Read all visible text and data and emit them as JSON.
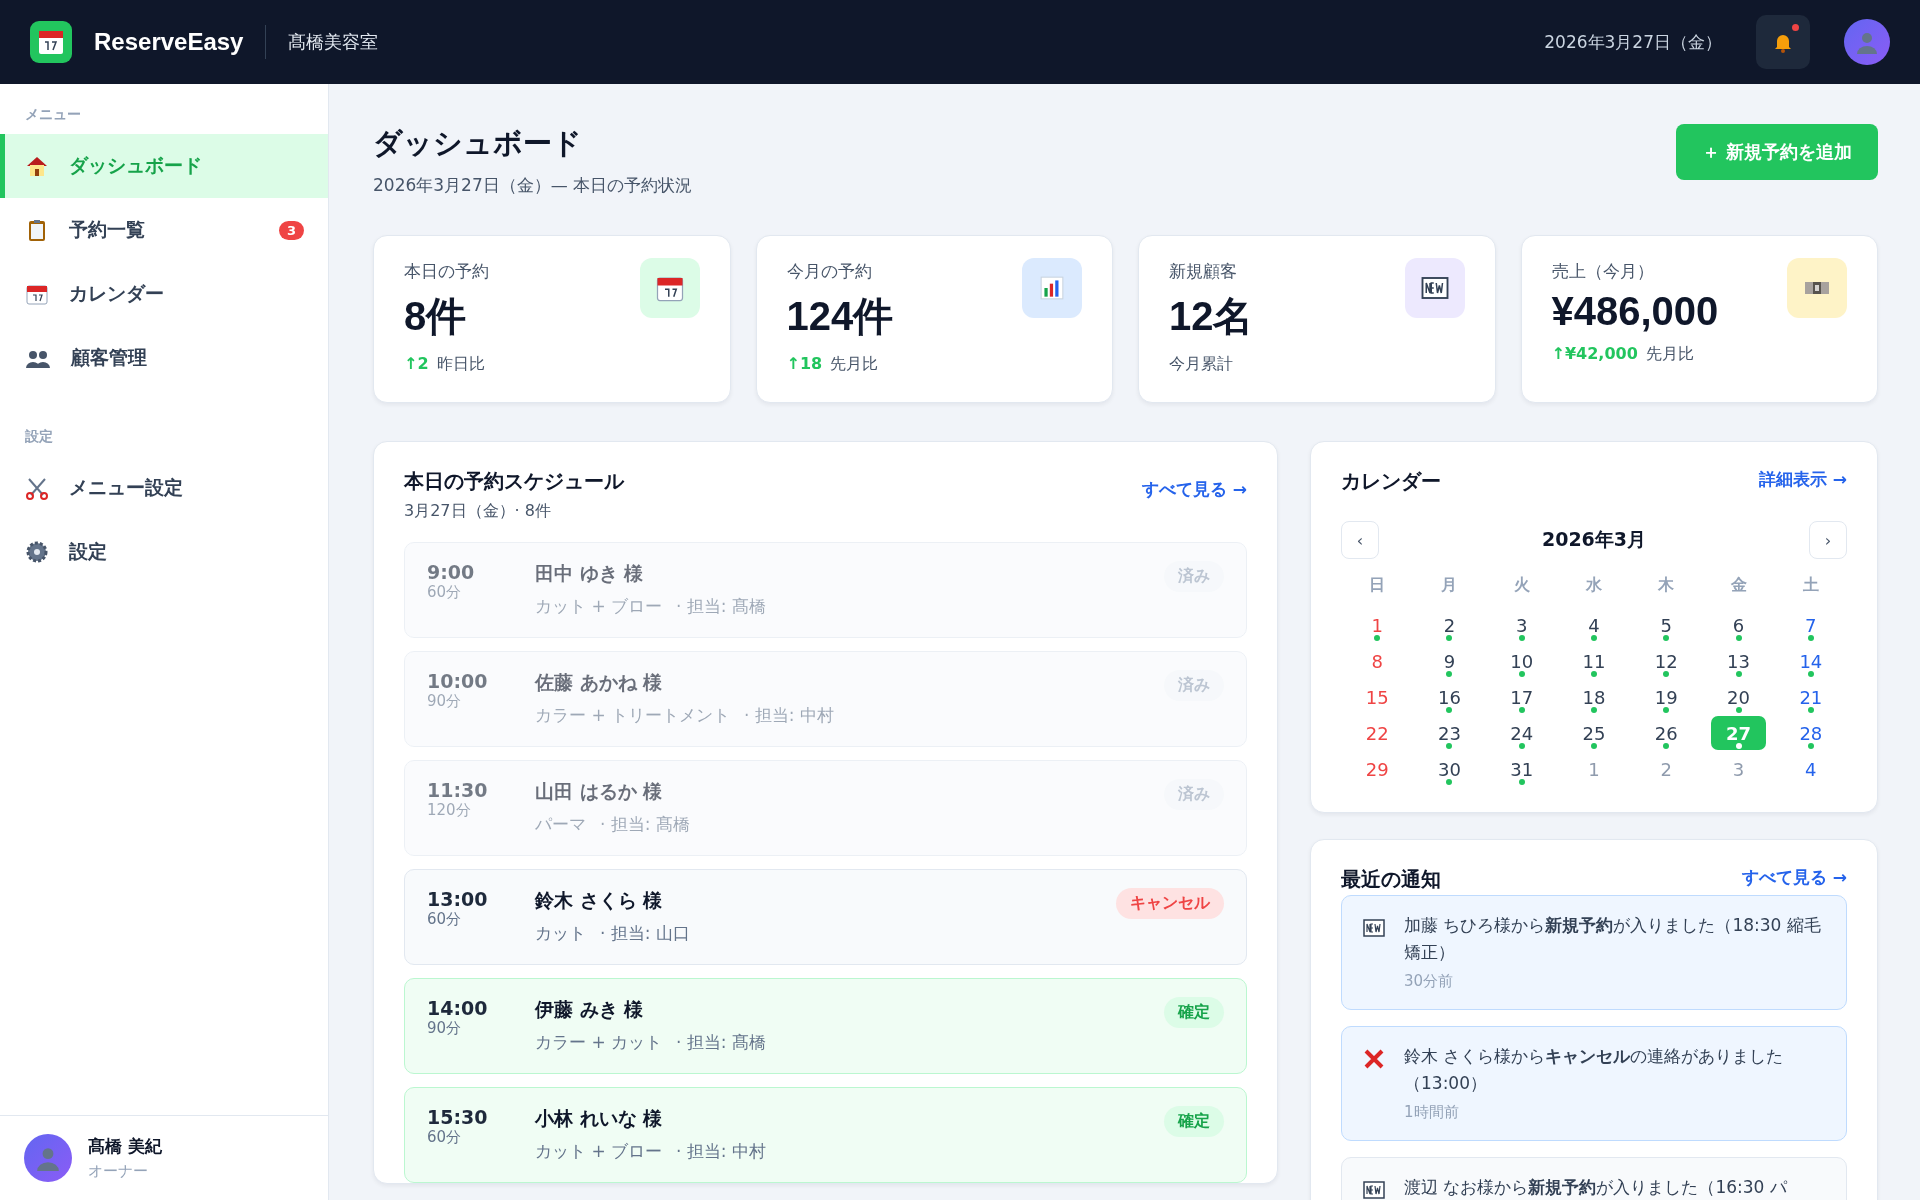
{
  "header": {
    "brand": "ReserveEasy",
    "shop": "髙橋美容室",
    "date": "2026年3月27日（金）",
    "has_unread": true
  },
  "sidebar": {
    "sections": [
      {
        "title": "メニュー",
        "items": [
          {
            "label": "ダッシュボード",
            "selected": true
          },
          {
            "label": "予約一覧",
            "selected": false,
            "badge": "3"
          },
          {
            "label": "カレンダー",
            "selected": false
          },
          {
            "label": "顧客管理",
            "selected": false
          }
        ]
      },
      {
        "title": "設定",
        "items": [
          {
            "label": "メニュー設定",
            "selected": false
          },
          {
            "label": "設定",
            "selected": false
          }
        ]
      }
    ],
    "user": {
      "name": "髙橋 美紀",
      "role": "オーナー"
    }
  },
  "page": {
    "title": "ダッシュボード",
    "subtitle": "2026年3月27日（金）— 本日の予約状況",
    "add_button": "＋ 新規予約を追加"
  },
  "stats": [
    {
      "label": "本日の予約",
      "value": "8件",
      "delta": "↑2",
      "note": "昨日比"
    },
    {
      "label": "今月の予約",
      "value": "124件",
      "delta": "↑18",
      "note": "先月比"
    },
    {
      "label": "新規顧客",
      "value": "12名",
      "note": "今月累計"
    },
    {
      "label": "売上（今月）",
      "value": "¥486,000",
      "delta": "↑¥42,000",
      "note": "先月比"
    }
  ],
  "schedule": {
    "title": "本日の予約スケジュール",
    "subtitle": "3月27日（金）· 8件",
    "link": "すべて見る →",
    "rows": [
      {
        "time": "9:00",
        "duration": "60分",
        "name": "田中 ゆき 様",
        "menu": "カット + ブロー",
        "staff": "· 担当: 髙橋",
        "status": "済み",
        "kind": "done"
      },
      {
        "time": "10:00",
        "duration": "90分",
        "name": "佐藤 あかね 様",
        "menu": "カラー + トリートメント",
        "staff": "· 担当: 中村",
        "status": "済み",
        "kind": "done"
      },
      {
        "time": "11:30",
        "duration": "120分",
        "name": "山田 はるか 様",
        "menu": "パーマ",
        "staff": "· 担当: 髙橋",
        "status": "済み",
        "kind": "done"
      },
      {
        "time": "13:00",
        "duration": "60分",
        "name": "鈴木 さくら 様",
        "menu": "カット",
        "staff": "· 担当: 山口",
        "status": "キャンセル",
        "kind": "cancel"
      },
      {
        "time": "14:00",
        "duration": "90分",
        "name": "伊藤 みき 様",
        "menu": "カラー + カット",
        "staff": "· 担当: 髙橋",
        "status": "確定",
        "kind": "confirmed"
      },
      {
        "time": "15:30",
        "duration": "60分",
        "name": "小林 れいな 様",
        "menu": "カット + ブロー",
        "staff": "· 担当: 中村",
        "status": "確定",
        "kind": "confirmed"
      }
    ]
  },
  "calendar": {
    "title": "カレンダー",
    "link": "詳細表示 →",
    "month": "2026年3月",
    "prev": "‹",
    "next": "›",
    "weekdays": [
      "日",
      "月",
      "火",
      "水",
      "木",
      "金",
      "土"
    ],
    "weeks": [
      [
        {
          "day": "1",
          "other": false,
          "dot": true,
          "selected": false
        },
        {
          "day": "2",
          "other": false,
          "dot": true,
          "selected": false
        },
        {
          "day": "3",
          "other": false,
          "dot": true,
          "selected": false
        },
        {
          "day": "4",
          "other": false,
          "dot": true,
          "selected": false
        },
        {
          "day": "5",
          "other": false,
          "dot": true,
          "selected": false
        },
        {
          "day": "6",
          "other": false,
          "dot": true,
          "selected": false
        },
        {
          "day": "7",
          "other": false,
          "dot": true,
          "selected": false
        }
      ],
      [
        {
          "day": "8",
          "other": false,
          "dot": false,
          "selected": false
        },
        {
          "day": "9",
          "other": false,
          "dot": true,
          "selected": false
        },
        {
          "day": "10",
          "other": false,
          "dot": true,
          "selected": false
        },
        {
          "day": "11",
          "other": false,
          "dot": true,
          "selected": false
        },
        {
          "day": "12",
          "other": false,
          "dot": true,
          "selected": false
        },
        {
          "day": "13",
          "other": false,
          "dot": true,
          "selected": false
        },
        {
          "day": "14",
          "other": false,
          "dot": true,
          "selected": false
        }
      ],
      [
        {
          "day": "15",
          "other": false,
          "dot": false,
          "selected": false
        },
        {
          "day": "16",
          "other": false,
          "dot": true,
          "selected": false
        },
        {
          "day": "17",
          "other": false,
          "dot": true,
          "selected": false
        },
        {
          "day": "18",
          "other": false,
          "dot": true,
          "selected": false
        },
        {
          "day": "19",
          "other": false,
          "dot": true,
          "selected": false
        },
        {
          "day": "20",
          "other": false,
          "dot": true,
          "selected": false
        },
        {
          "day": "21",
          "other": false,
          "dot": true,
          "selected": false
        }
      ],
      [
        {
          "day": "22",
          "other": false,
          "dot": false,
          "selected": false
        },
        {
          "day": "23",
          "other": false,
          "dot": true,
          "selected": false
        },
        {
          "day": "24",
          "other": false,
          "dot": true,
          "selected": false
        },
        {
          "day": "25",
          "other": false,
          "dot": true,
          "selected": false
        },
        {
          "day": "26",
          "other": false,
          "dot": true,
          "selected": false
        },
        {
          "day": "27",
          "other": false,
          "dot": true,
          "selected": true
        },
        {
          "day": "28",
          "other": false,
          "dot": true,
          "selected": false
        }
      ],
      [
        {
          "day": "29",
          "other": false,
          "dot": false,
          "selected": false
        },
        {
          "day": "30",
          "other": false,
          "dot": true,
          "selected": false
        },
        {
          "day": "31",
          "other": false,
          "dot": true,
          "selected": false
        },
        {
          "day": "1",
          "other": true,
          "dot": false,
          "selected": false
        },
        {
          "day": "2",
          "other": true,
          "dot": false,
          "selected": false
        },
        {
          "day": "3",
          "other": true,
          "dot": false,
          "selected": false
        },
        {
          "day": "4",
          "other": true,
          "dot": false,
          "selected": false
        }
      ]
    ]
  },
  "notifications": {
    "title": "最近の通知",
    "link": "すべて見る →",
    "items": [
      {
        "kind": "new",
        "text": "加藤 ちひろ様から**新規予約**が入りました（18:30 縮毛矯正）",
        "time": "30分前",
        "unread": true
      },
      {
        "kind": "cancel",
        "text": "鈴木 さくら様から**キャンセル**の連絡がありました（13:00）",
        "time": "1時間前",
        "unread": true
      },
      {
        "kind": "new",
        "text": "渡辺 なお様から**新規予約**が入りました（16:30 パ",
        "unread": false
      }
    ]
  }
}
